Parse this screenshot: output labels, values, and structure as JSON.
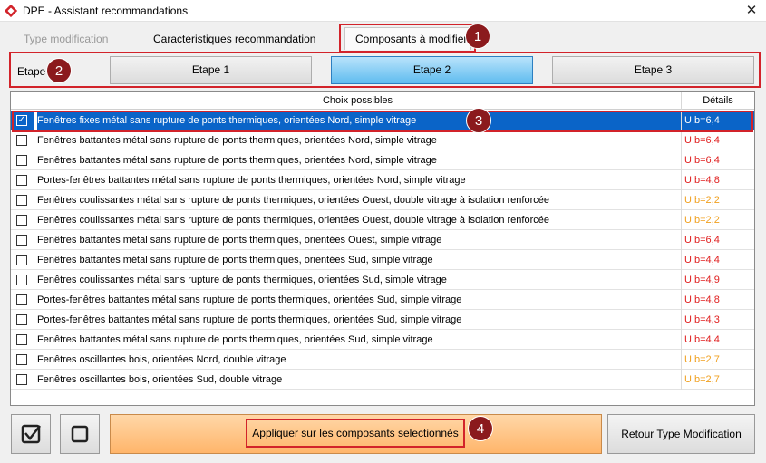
{
  "window": {
    "title": "DPE - Assistant recommandations",
    "close_glyph": "✕"
  },
  "tabs": [
    {
      "label": "Type modification",
      "state": "disabled"
    },
    {
      "label": "Caracteristiques recommandation",
      "state": "normal"
    },
    {
      "label": "Composants à modifier",
      "state": "active"
    }
  ],
  "etape": {
    "label": "Etape",
    "steps": [
      "Etape 1",
      "Etape 2",
      "Etape 3"
    ],
    "active_index": 1
  },
  "grid": {
    "headers": {
      "choices": "Choix possibles",
      "details": "Détails"
    },
    "rows": [
      {
        "text": "Fenêtres fixes métal sans rupture de ponts thermiques, orientées Nord, simple vitrage",
        "value": "U.b=6,4",
        "checked": true,
        "selected": true
      },
      {
        "text": "Fenêtres battantes métal sans rupture de ponts thermiques, orientées Nord, simple vitrage",
        "value": "U.b=6,4",
        "checked": false
      },
      {
        "text": "Fenêtres battantes métal sans rupture de ponts thermiques, orientées Nord, simple vitrage",
        "value": "U.b=6,4",
        "checked": false
      },
      {
        "text": "Portes-fenêtres battantes métal sans rupture de ponts thermiques, orientées Nord, simple vitrage",
        "value": "U.b=4,8",
        "checked": false
      },
      {
        "text": "Fenêtres coulissantes métal sans rupture de ponts thermiques, orientées Ouest, double vitrage à isolation renforcée",
        "value": "U.b=2,2",
        "checked": false
      },
      {
        "text": "Fenêtres coulissantes métal sans rupture de ponts thermiques, orientées Ouest, double vitrage à isolation renforcée",
        "value": "U.b=2,2",
        "checked": false
      },
      {
        "text": "Fenêtres battantes métal sans rupture de ponts thermiques, orientées Ouest, simple vitrage",
        "value": "U.b=6,4",
        "checked": false
      },
      {
        "text": "Fenêtres battantes métal sans rupture de ponts thermiques, orientées Sud, simple vitrage",
        "value": "U.b=4,4",
        "checked": false
      },
      {
        "text": "Fenêtres coulissantes métal sans rupture de ponts thermiques, orientées Sud, simple vitrage",
        "value": "U.b=4,9",
        "checked": false
      },
      {
        "text": "Portes-fenêtres battantes métal sans rupture de ponts thermiques, orientées Sud, simple vitrage",
        "value": "U.b=4,8",
        "checked": false
      },
      {
        "text": "Portes-fenêtres battantes métal sans rupture de ponts thermiques, orientées Sud, simple vitrage",
        "value": "U.b=4,3",
        "checked": false
      },
      {
        "text": "Fenêtres battantes métal sans rupture de ponts thermiques, orientées Sud, simple vitrage",
        "value": "U.b=4,4",
        "checked": false
      },
      {
        "text": "Fenêtres oscillantes bois, orientées Nord, double vitrage",
        "value": "U.b=2,7",
        "checked": false
      },
      {
        "text": "Fenêtres oscillantes bois, orientées Sud, double vitrage",
        "value": "U.b=2,7",
        "checked": false
      }
    ]
  },
  "colors": {
    "value_red": "#e02020",
    "value_orange": "#f0a020",
    "selection_blue": "#0a64c8",
    "annotation_red": "#d2232a",
    "badge": "#8b1a1d"
  },
  "buttons": {
    "check_all_icon": "check-all-icon",
    "uncheck_all_icon": "uncheck-all-icon",
    "apply": "Appliquer sur les composants selectionnés",
    "return": "Retour Type Modification"
  },
  "annotations": [
    "1",
    "2",
    "3",
    "4"
  ]
}
